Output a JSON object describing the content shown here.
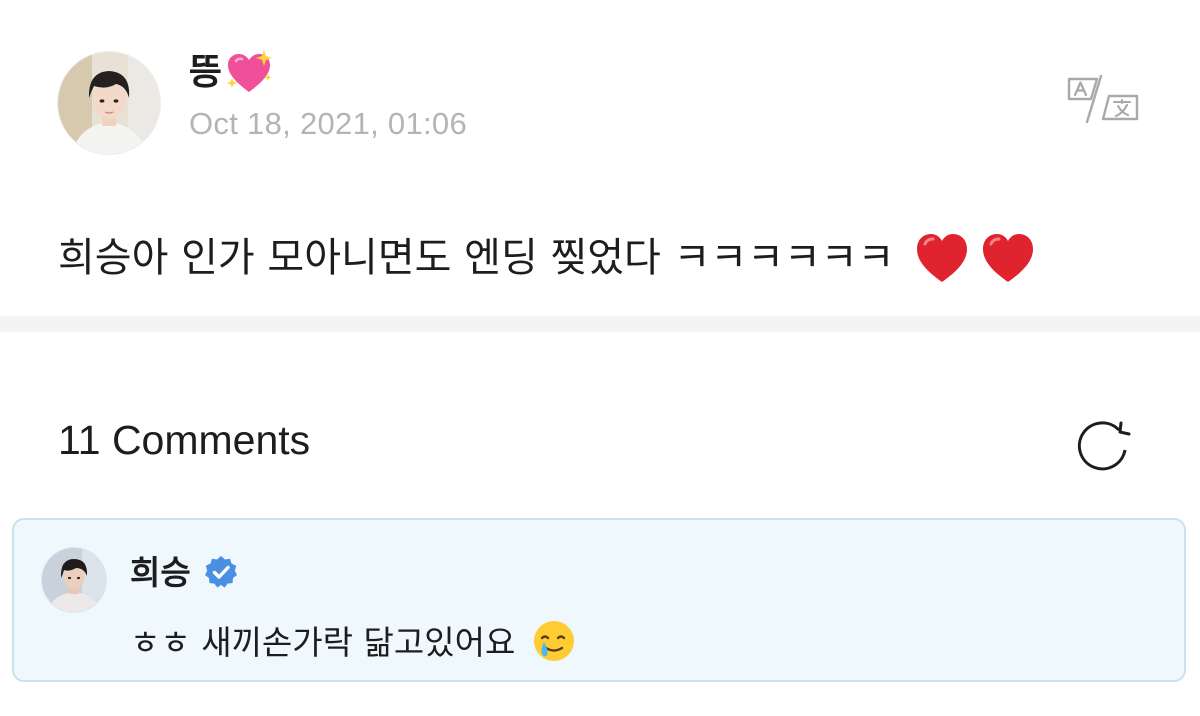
{
  "post": {
    "author_name": "뜽",
    "author_emoji": "sparkling-heart-emoji",
    "timestamp": "Oct 18, 2021, 01:06",
    "text": "희승아 인가 모아니면도 엔딩 찢었다 ㅋㅋㅋㅋㅋㅋ",
    "trailing_emojis": [
      "red-heart-emoji",
      "red-heart-emoji"
    ],
    "translate_icon": "translate-icon"
  },
  "comments": {
    "title": "11 Comments",
    "refresh_icon": "refresh-icon",
    "items": [
      {
        "author": "희승",
        "verified": true,
        "text": "ㅎㅎ 새끼손가락 닮고있어요",
        "emoji": "smiling-face-with-tear-emoji"
      }
    ]
  },
  "colors": {
    "card_background": "#eef8fd",
    "card_border": "#c8e1ef",
    "verified_blue": "#4a90e2",
    "timestamp_gray": "#b4b4b4",
    "divider": "#f3f4f6",
    "heart_red": "#e0242f",
    "sparkle_pink": "#f0509a"
  }
}
